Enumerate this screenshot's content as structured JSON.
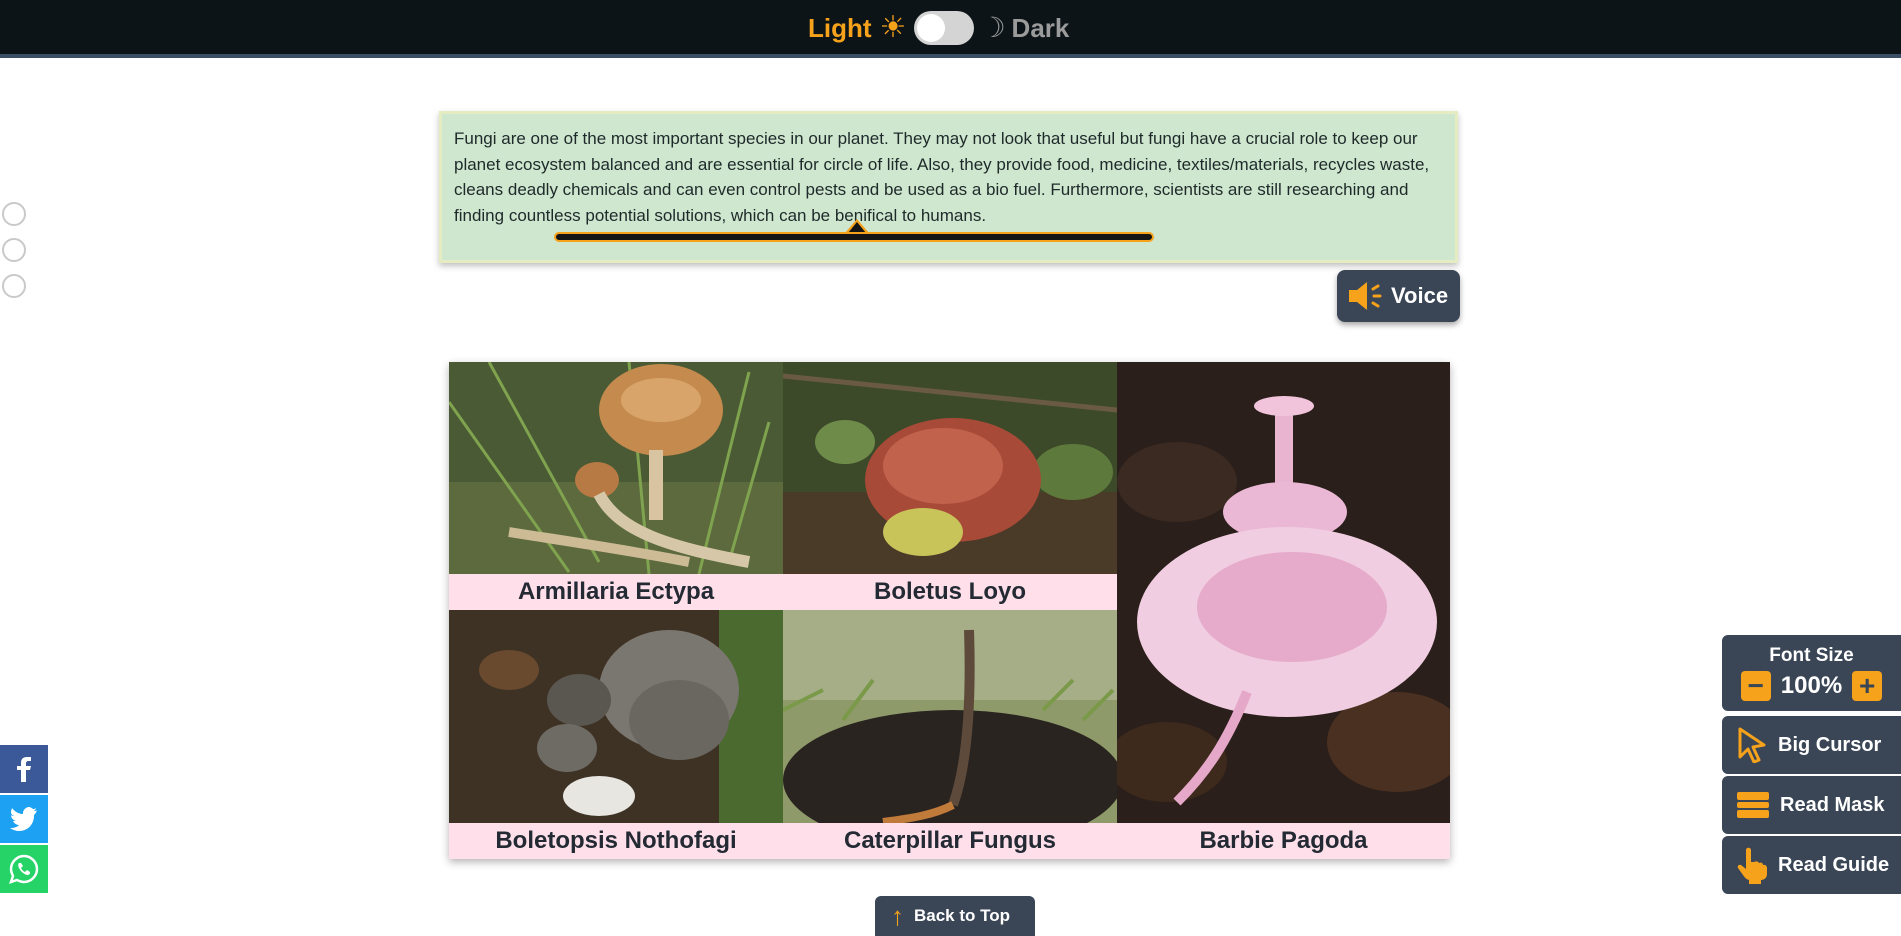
{
  "theme_toggle": {
    "light_label": "Light",
    "dark_label": "Dark",
    "sun_glyph": "☀",
    "moon_glyph": "☽",
    "state": "light"
  },
  "intro": {
    "text": "Fungi are one of the most important species in our planet. They may not look that useful but fungi have a crucial role to keep our planet ecosystem balanced and are essential for circle of life. Also, they provide food, medicine, textiles/materials, recycles waste, cleans deadly chemicals and can even control pests and be used as a bio fuel. Furthermore, scientists are still researching and finding countless potential solutions, which can be benifical to humans."
  },
  "voice_button": {
    "label": "Voice"
  },
  "gallery": {
    "cards": [
      {
        "name": "Armillaria Ectypa"
      },
      {
        "name": "Boletus Loyo"
      },
      {
        "name": "Barbie Pagoda"
      },
      {
        "name": "Boletopsis Nothofagi"
      },
      {
        "name": "Caterpillar Fungus"
      }
    ]
  },
  "back_to_top": {
    "label": "Back to Top"
  },
  "accessibility": {
    "font_size_title": "Font Size",
    "font_size_value": "100%",
    "decrease_glyph": "−",
    "increase_glyph": "+",
    "big_cursor_label": "Big Cursor",
    "read_mask_label": "Read Mask",
    "read_guide_label": "Read Guide"
  },
  "social": [
    "facebook-icon",
    "twitter-icon",
    "whatsapp-icon"
  ],
  "colors": {
    "accent": "#f7a21b",
    "panel": "#3a4656",
    "topbar": "#0c1418",
    "intro_bg": "#cfe6cf",
    "caption_bg": "#ffe0ea"
  }
}
